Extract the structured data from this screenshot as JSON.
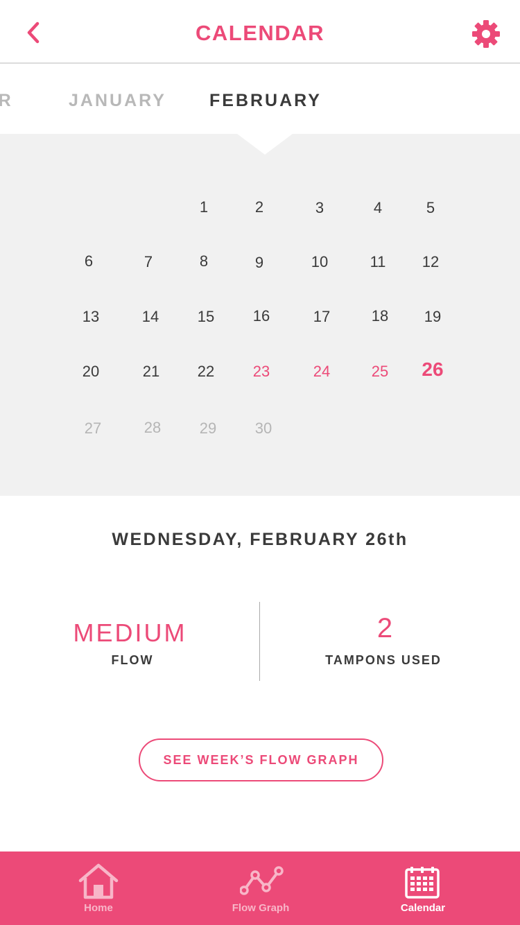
{
  "header": {
    "title": "CALENDAR",
    "back_icon": "chevron-left-icon",
    "settings_icon": "gear-icon",
    "accent_color": "#ec4a78"
  },
  "months": {
    "previous_partial": "ER",
    "january": "JANUARY",
    "february": "FEBRUARY",
    "selected": "FEBRUARY"
  },
  "calendar": {
    "selected_day": "26",
    "days": [
      "1",
      "2",
      "3",
      "4",
      "5",
      "6",
      "7",
      "8",
      "9",
      "10",
      "11",
      "12",
      "13",
      "14",
      "15",
      "16",
      "17",
      "18",
      "19",
      "20",
      "21",
      "22",
      "23",
      "24",
      "25",
      "26",
      "27",
      "28",
      "29",
      "30"
    ],
    "period_days": [
      "23",
      "24",
      "25",
      "26"
    ],
    "dimmed_days": [
      "27",
      "28",
      "29",
      "30"
    ]
  },
  "detail": {
    "date": "WEDNESDAY, FEBRUARY 26th",
    "flow_value": "MEDIUM",
    "flow_label": "FLOW",
    "tampons_value": "2",
    "tampons_label": "TAMPONS USED"
  },
  "actions": {
    "week_graph_button": "SEE WEEK’S FLOW GRAPH"
  },
  "tabbar": {
    "home": "Home",
    "flow_graph": "Flow Graph",
    "calendar": "Calendar",
    "active": "Calendar",
    "icons": [
      "home-icon",
      "flow-graph-icon",
      "calendar-icon"
    ]
  }
}
